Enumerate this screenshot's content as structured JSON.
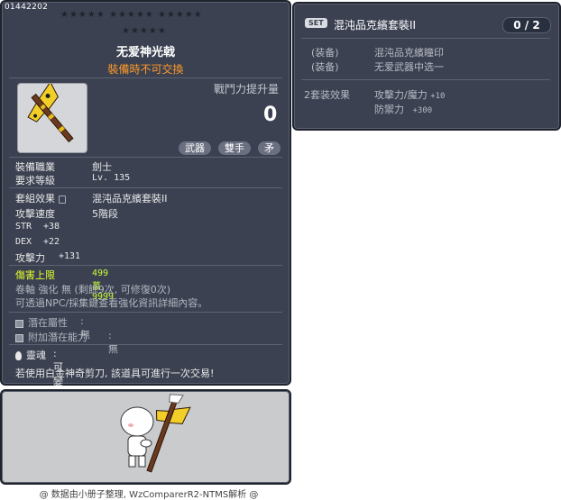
{
  "item": {
    "id": "01442202",
    "star_rows": [
      "★★★★★ ★★★★★ ★★★★★",
      "★★★★★"
    ],
    "name": "无爱神光戟",
    "trade_note": "裝備時不可交換",
    "stat_label": "戰鬥力提升量",
    "stat_value": "0",
    "tags": [
      "武器",
      "雙手",
      "矛"
    ],
    "job_label": "裝備職業",
    "job_value": "劍士",
    "level_label": "要求等級",
    "level_value": "Lv. 135",
    "set_label": "套組效果",
    "set_value": "混沌品克繽套裝II",
    "speed_label": "攻擊速度",
    "speed_value": "5階段",
    "str_label": "STR",
    "str_value": "+38",
    "dex_label": "DEX",
    "dex_value": "+22",
    "atk_label": "攻擊力",
    "atk_value": "+131",
    "damage_cap_label": "傷害上限",
    "damage_cap_value": "499萬 9999",
    "scroll_line": "卷軸 強化 無 (剩餘9次, 可修復0次)",
    "npc_line": "可透過NPC/採集鍵查看強化資訊詳細內容。",
    "potential_label": "潛在屬性",
    "potential_value": ": 無",
    "additional_label": "附加潛在能力",
    "additional_value": ": 無",
    "soul_label": "靈魂",
    "soul_value": ": 可變換為靈魂武器",
    "scissor_line": "若使用白金神奇剪刀, 該道具可進行一次交易!"
  },
  "set_panel": {
    "badge": "SET",
    "name": "混沌品克繽套裝II",
    "count": "0 / 2",
    "equip_label_1": "(装备)",
    "equip_value_1": "混沌品克繽瞳印",
    "equip_label_2": "(装备)",
    "equip_value_2": "无爱武器中选一",
    "effect_label": "2套装效果",
    "effect_line_1_k": "攻擊力/魔力",
    "effect_line_1_v": "+10",
    "effect_line_2_k": "防禦力",
    "effect_line_2_v": "+300"
  },
  "footer": "@ 数据由小册子整理, WzComparerR2-NTMS解析 @",
  "colors": {
    "panel": "#3b4151",
    "accent_orange": "#ff9a2a",
    "accent_yellow": "#e6ff2c"
  }
}
